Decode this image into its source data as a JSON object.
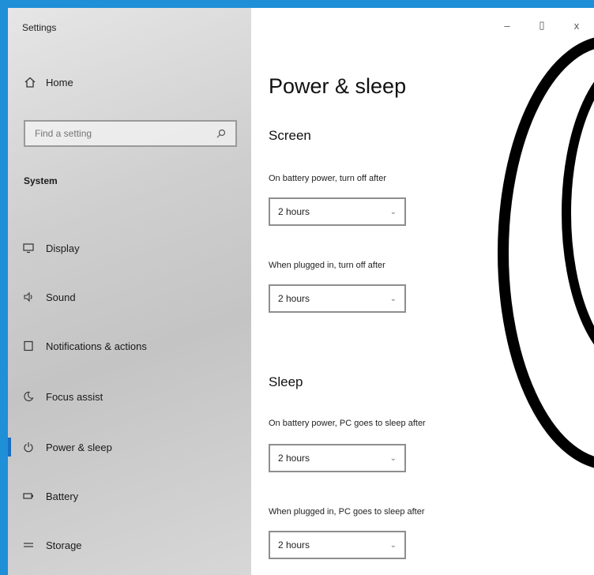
{
  "window": {
    "title": "Settings",
    "controls": {
      "minimize": "–",
      "maximize": "▯",
      "close": "x"
    }
  },
  "sidebar": {
    "home_label": "Home",
    "search_placeholder": "Find a setting",
    "section": "System",
    "items": [
      {
        "label": "Display",
        "icon": "display-icon"
      },
      {
        "label": "Sound",
        "icon": "sound-icon"
      },
      {
        "label": "Notifications & actions",
        "icon": "notifications-icon"
      },
      {
        "label": "Focus assist",
        "icon": "focus-assist-icon"
      },
      {
        "label": "Power & sleep",
        "icon": "power-icon",
        "active": true
      },
      {
        "label": "Battery",
        "icon": "battery-icon"
      },
      {
        "label": "Storage",
        "icon": "storage-icon"
      }
    ]
  },
  "main": {
    "title": "Power & sleep",
    "screen": {
      "heading": "Screen",
      "battery_label": "On battery power, turn off after",
      "battery_value": "2 hours",
      "plugged_label": "When plugged in, turn off after",
      "plugged_value": "2 hours"
    },
    "sleep": {
      "heading": "Sleep",
      "battery_label": "On battery power, PC goes to sleep after",
      "battery_value": "2 hours",
      "plugged_label": "When plugged in, PC goes to sleep after",
      "plugged_value": "2 hours"
    }
  },
  "colors": {
    "accent": "#1a6fc2",
    "frame": "#1f8fd8",
    "sidebar": "#d0d0d0"
  }
}
